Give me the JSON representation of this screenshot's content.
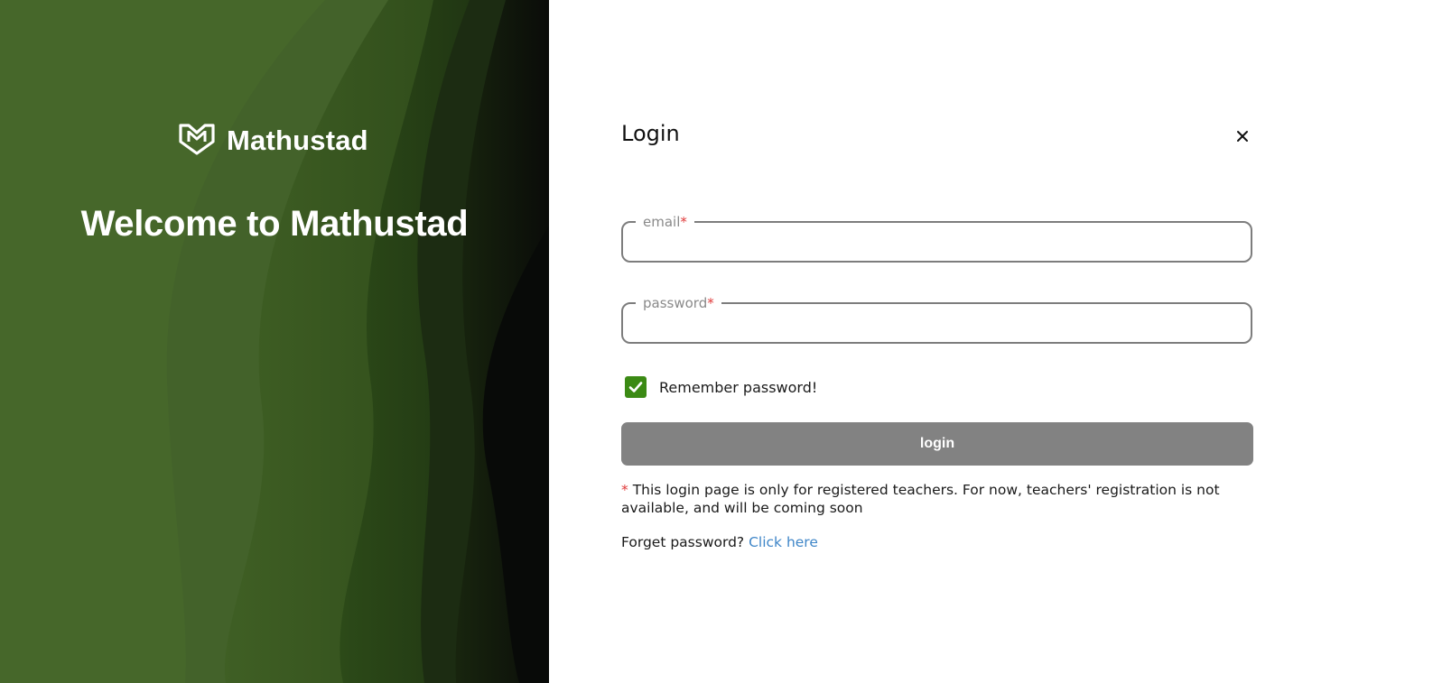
{
  "hero": {
    "brand_name": "Mathustad",
    "welcome": "Welcome to Mathustad",
    "colors": {
      "base": "#46672a",
      "dark": "#0b0f0a",
      "accent": "#2f4f1c"
    }
  },
  "form": {
    "title": "Login",
    "close_glyph": "×",
    "email_label": "email",
    "email_value": "",
    "password_label": "password",
    "password_value": "",
    "required_mark": "*",
    "remember_label": "Remember password!",
    "remember_checked": true,
    "login_label": "login",
    "note_mark": "*",
    "note_text": "This login page is only for registered teachers. For now, teachers' registration is not available, and will be coming soon",
    "forget_text": "Forget password?",
    "forget_link": "Click here"
  },
  "icons": {
    "logo": "mathustad-shield-logo-icon",
    "close": "close-icon",
    "check": "checkmark-icon"
  },
  "colors": {
    "checkbox": "#3b8a14",
    "button": "#828282",
    "link": "#3f86c8",
    "required": "#e03a3a"
  }
}
